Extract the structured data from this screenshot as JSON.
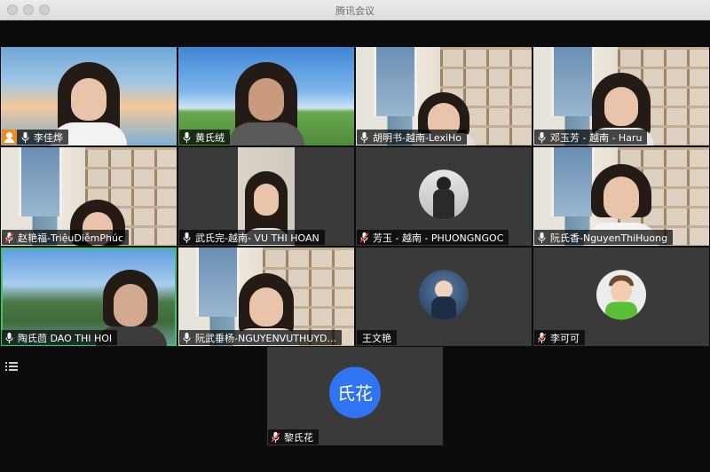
{
  "window": {
    "title": "腾讯会议"
  },
  "participants": [
    {
      "name": "李佳烨",
      "mic": "on",
      "host": true
    },
    {
      "name": "黄氏绒",
      "mic": "on"
    },
    {
      "name": "胡明书-越南-LexiHo",
      "mic": "on"
    },
    {
      "name": "邓玉芳 - 越南 - Haru",
      "mic": "on"
    },
    {
      "name": "赵艳福-TriệuDiễmPhúc",
      "mic": "off"
    },
    {
      "name": "武氏完-越南- VU THI HOAN",
      "mic": "on"
    },
    {
      "name": "芳玉 - 越南 - PHUONGNGOC",
      "mic": "off"
    },
    {
      "name": "阮氏香-NguyenThiHuong",
      "mic": "on"
    },
    {
      "name": "陶氏茴 DAO THI HOI",
      "mic": "on",
      "speaking": true
    },
    {
      "name": "阮武垂杨-NGUYENVUTHUYD...",
      "mic": "on"
    },
    {
      "name": "王文艳",
      "mic": "none"
    },
    {
      "name": "李可可",
      "mic": "off"
    },
    {
      "name": "黎氏花",
      "mic": "off",
      "avatar_text": "氏花"
    }
  ],
  "icons": {
    "mic_on": "microphone-icon",
    "mic_off": "microphone-muted-icon",
    "host": "host-icon",
    "list": "participant-list-icon"
  },
  "colors": {
    "speaking": "#2ecc71",
    "avatar_blue": "#2f74f0",
    "host": "#f08b22"
  }
}
